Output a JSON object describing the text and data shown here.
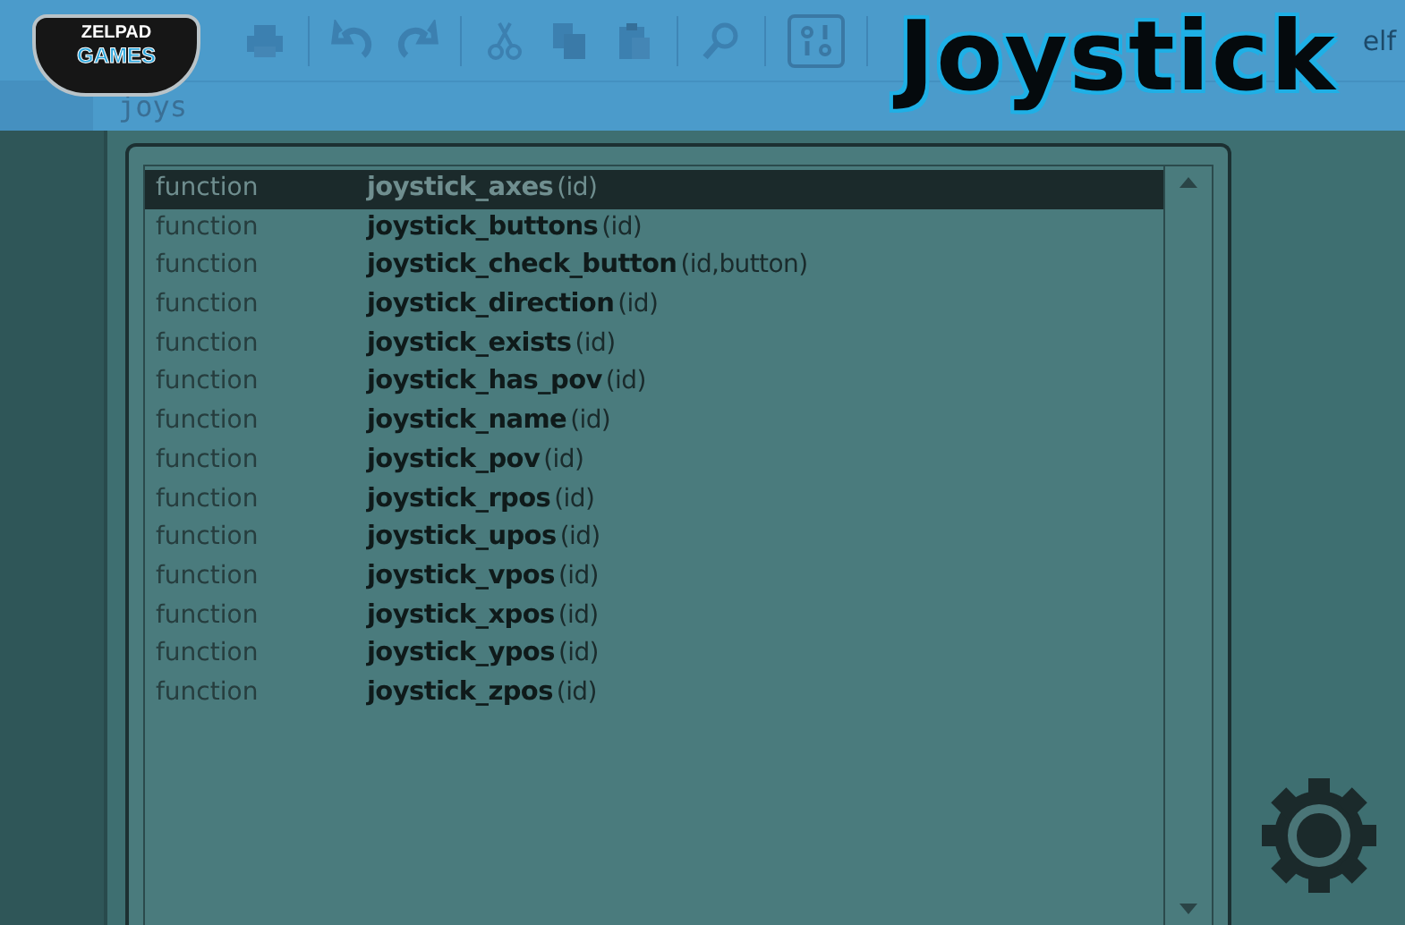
{
  "logo": {
    "line1": "ZELPAD",
    "line2": "GAMES"
  },
  "title": "Joystick",
  "toolbar": {
    "trailing_text": "elf"
  },
  "editor": {
    "code": "joys"
  },
  "autocomplete": {
    "items": [
      {
        "kind": "function",
        "name": "joystick_axes",
        "args": "(id)",
        "selected": true
      },
      {
        "kind": "function",
        "name": "joystick_buttons",
        "args": "(id)",
        "selected": false
      },
      {
        "kind": "function",
        "name": "joystick_check_button",
        "args": "(id,button)",
        "selected": false
      },
      {
        "kind": "function",
        "name": "joystick_direction",
        "args": "(id)",
        "selected": false
      },
      {
        "kind": "function",
        "name": "joystick_exists",
        "args": "(id)",
        "selected": false
      },
      {
        "kind": "function",
        "name": "joystick_has_pov",
        "args": "(id)",
        "selected": false
      },
      {
        "kind": "function",
        "name": "joystick_name",
        "args": "(id)",
        "selected": false
      },
      {
        "kind": "function",
        "name": "joystick_pov",
        "args": "(id)",
        "selected": false
      },
      {
        "kind": "function",
        "name": "joystick_rpos",
        "args": "(id)",
        "selected": false
      },
      {
        "kind": "function",
        "name": "joystick_upos",
        "args": "(id)",
        "selected": false
      },
      {
        "kind": "function",
        "name": "joystick_vpos",
        "args": "(id)",
        "selected": false
      },
      {
        "kind": "function",
        "name": "joystick_xpos",
        "args": "(id)",
        "selected": false
      },
      {
        "kind": "function",
        "name": "joystick_ypos",
        "args": "(id)",
        "selected": false
      },
      {
        "kind": "function",
        "name": "joystick_zpos",
        "args": "(id)",
        "selected": false
      }
    ]
  }
}
